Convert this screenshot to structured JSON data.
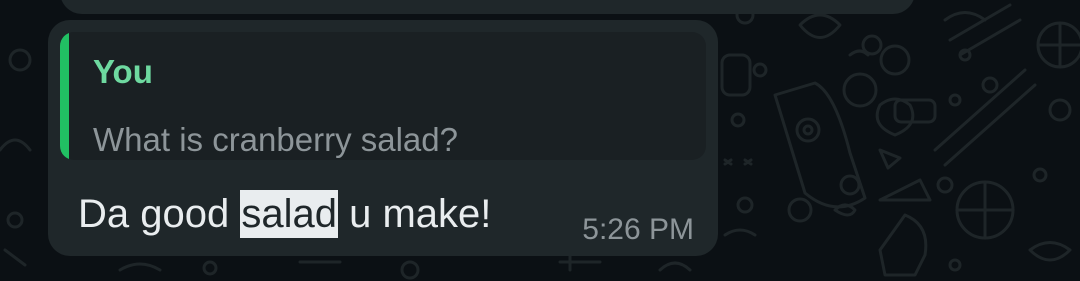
{
  "colors": {
    "chat_background": "#0b1014",
    "bubble_background": "#1f272a",
    "quote_background": "#1a2023",
    "quote_bar": "#21c063",
    "quote_sender": "#6ed9a0",
    "secondary_text": "#8d9599",
    "primary_text": "#e9edef",
    "selection_highlight": "#e9edef"
  },
  "message": {
    "quoted": {
      "sender": "You",
      "text": "What is cranberry salad?"
    },
    "text_before": "Da good ",
    "text_selected": "salad",
    "text_after": " u make!",
    "time": "5:26 PM"
  }
}
